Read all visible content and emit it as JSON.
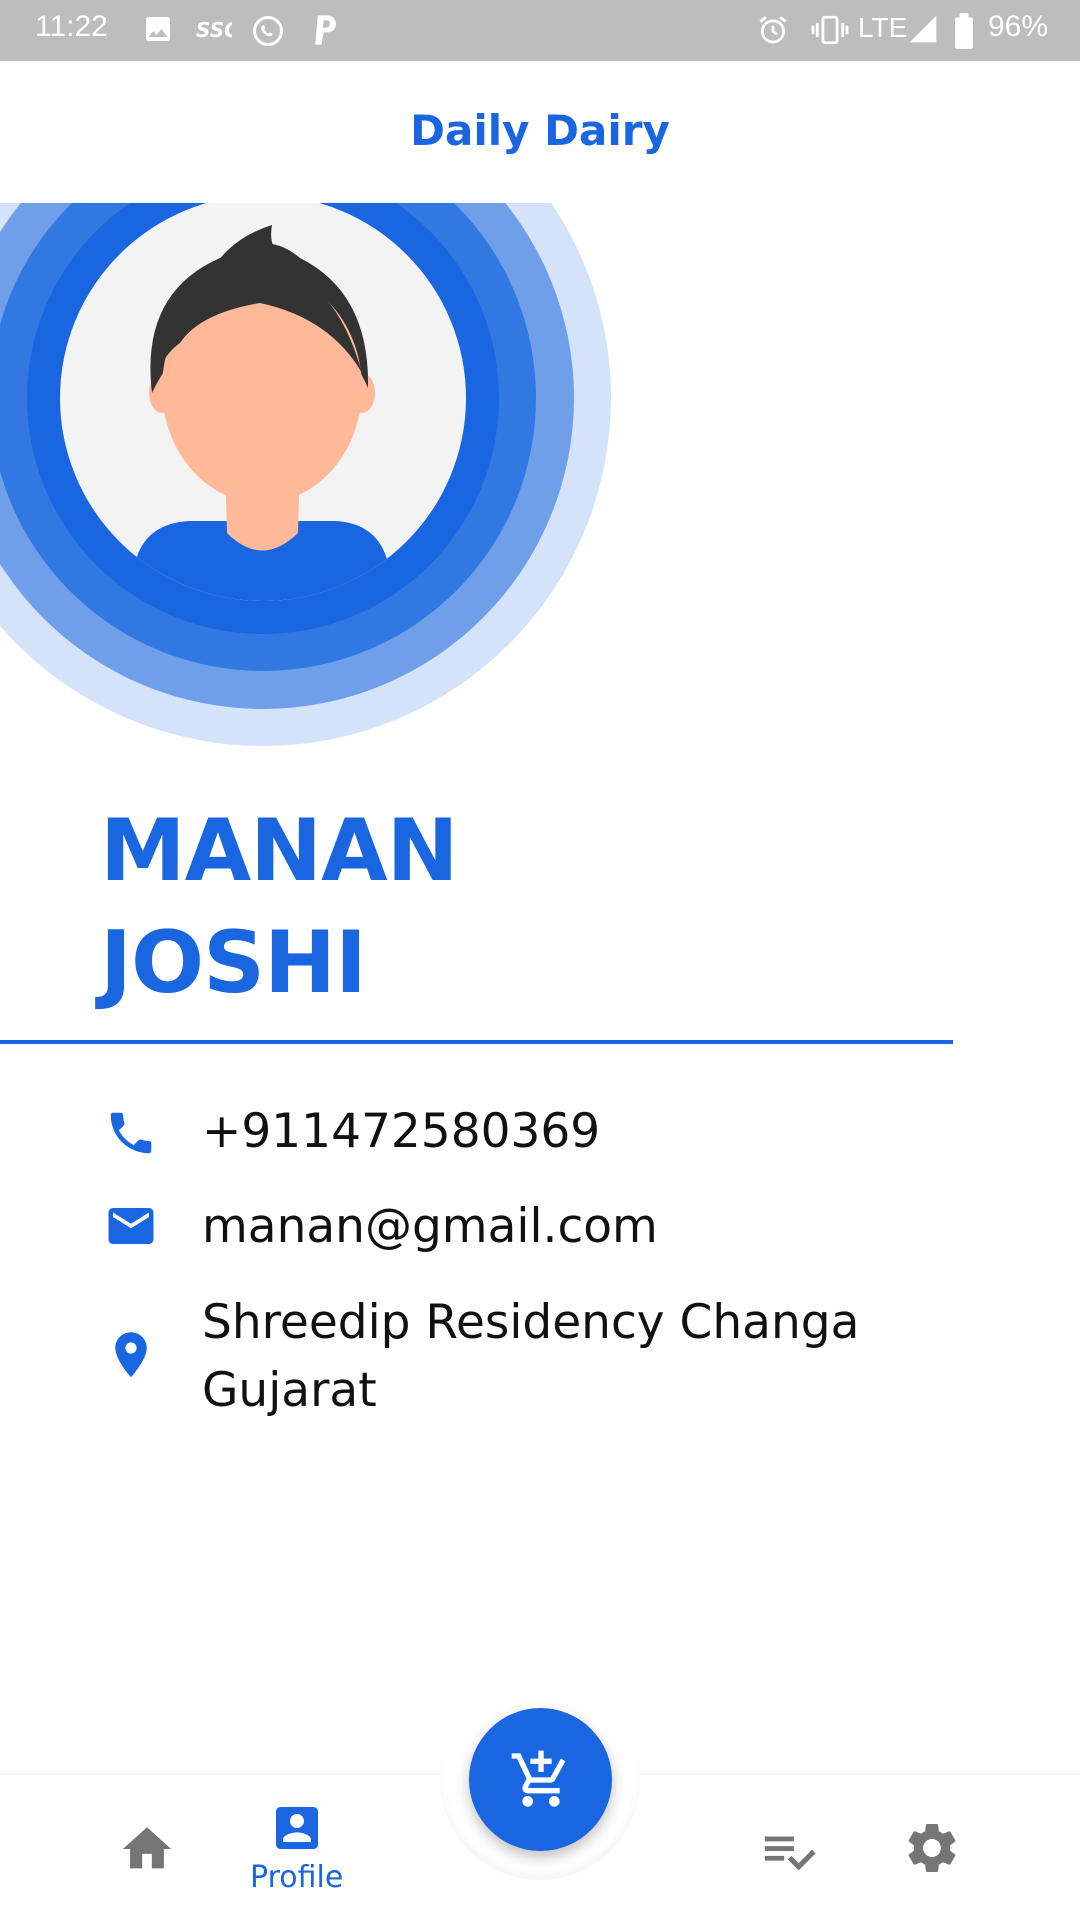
{
  "status_bar": {
    "time": "11:22",
    "network": "LTE",
    "battery": "96%",
    "icons": [
      "image-icon",
      "ssg-icon",
      "whatsapp-icon",
      "paytm-icon",
      "alarm-icon",
      "vibrate-icon",
      "signal-icon",
      "battery-icon"
    ]
  },
  "app_bar": {
    "title": "Daily Dairy"
  },
  "profile": {
    "first_name": "MANAN",
    "last_name": "JOSHI",
    "avatar_icon": "user-avatar-illustration"
  },
  "contact": {
    "phone": "+911472580369",
    "email": "manan@gmail.com",
    "address_line1": "Shreedip Residency Changa",
    "address_line2": "Gujarat"
  },
  "bottom_nav": {
    "items": [
      {
        "icon": "home-icon",
        "label": ""
      },
      {
        "icon": "profile-icon",
        "label": "Profile"
      },
      {
        "icon": "orders-list-icon",
        "label": ""
      },
      {
        "icon": "settings-icon",
        "label": ""
      }
    ],
    "fab_icon": "add-to-cart-icon"
  },
  "colors": {
    "primary": "#1a66e0",
    "status_bar": "#bdbdbd",
    "text": "#111111",
    "icon_inactive": "#757575"
  }
}
